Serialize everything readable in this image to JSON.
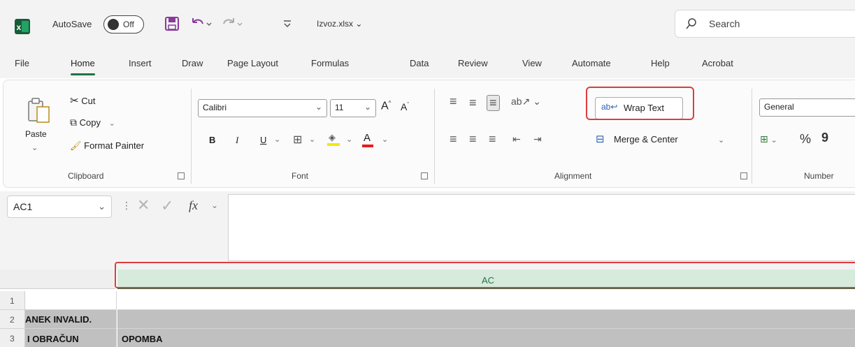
{
  "titlebar": {
    "autosave_label": "AutoSave",
    "autosave_state": "Off",
    "filename": "Izvoz.xlsx",
    "search_placeholder": "Search"
  },
  "tabs": [
    "File",
    "Home",
    "Insert",
    "Draw",
    "Page Layout",
    "Formulas",
    "Data",
    "Review",
    "View",
    "Automate",
    "Help",
    "Acrobat"
  ],
  "active_tab": "Home",
  "ribbon": {
    "clipboard": {
      "paste": "Paste",
      "cut": "Cut",
      "copy": "Copy",
      "format_painter": "Format Painter",
      "label": "Clipboard"
    },
    "font": {
      "name": "Calibri",
      "size": "11",
      "bold": "B",
      "italic": "I",
      "underline": "U",
      "label": "Font"
    },
    "alignment": {
      "wrap_text": "Wrap Text",
      "merge_center": "Merge & Center",
      "label": "Alignment"
    },
    "number": {
      "format": "General",
      "percent": "%",
      "comma": "9",
      "label": "Number"
    }
  },
  "formula_bar": {
    "name_box": "AC1",
    "fx": "fx"
  },
  "grid": {
    "column_header": "AC",
    "rows": [
      {
        "num": "1",
        "left": "",
        "ac": ""
      },
      {
        "num": "2",
        "left": "ANEK INVALID.",
        "ac": ""
      },
      {
        "num": "3",
        "left": "I OBRAČUN",
        "ac": "OPOMBA"
      }
    ]
  },
  "colors": {
    "accent": "#217346",
    "highlight": "#e03c3c",
    "selected_col": "#d6ebdc",
    "row2_fill": "#c0c0c0"
  }
}
